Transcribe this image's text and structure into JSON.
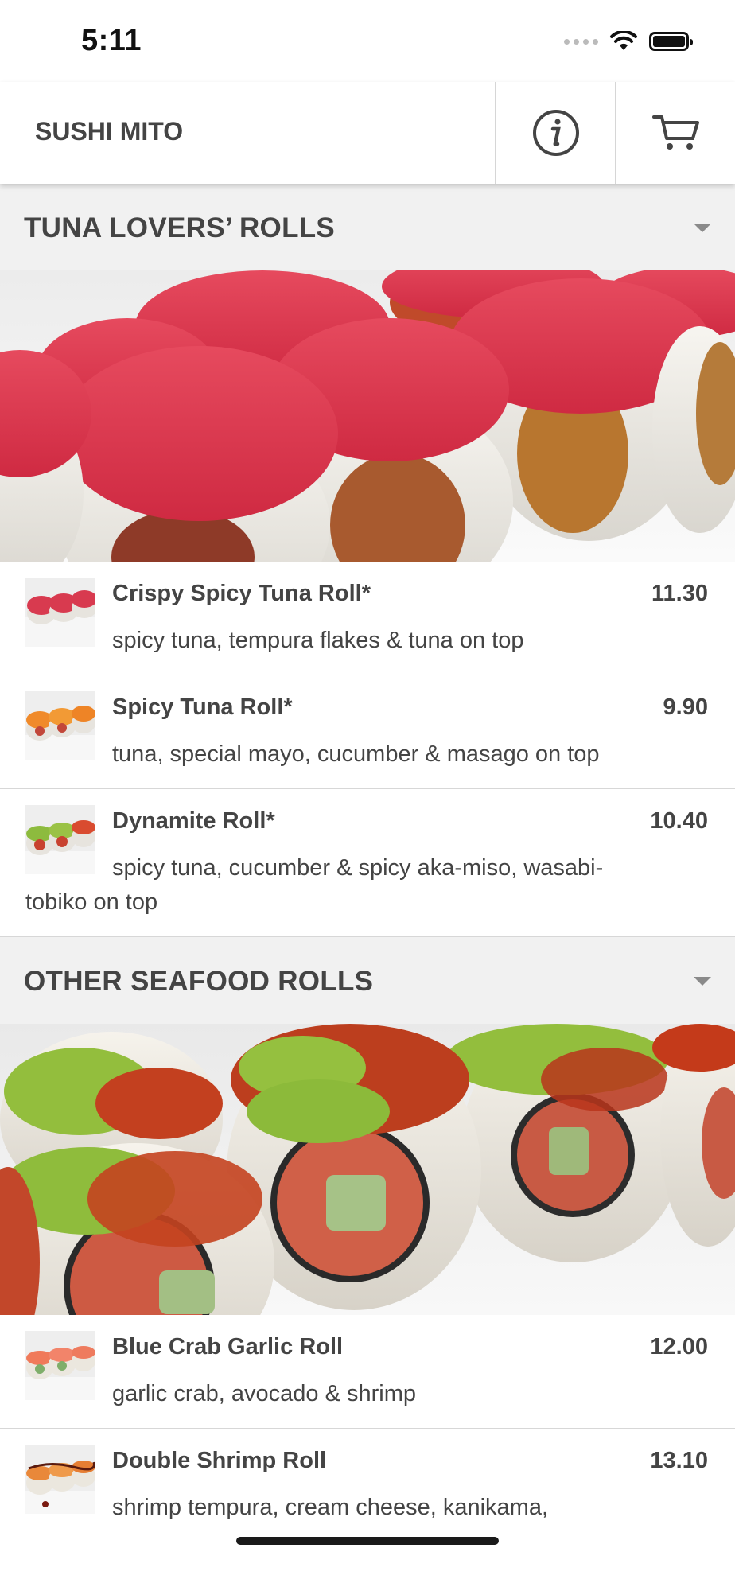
{
  "status": {
    "time": "5:11"
  },
  "navbar": {
    "title": "SUSHI MITO"
  },
  "sections": [
    {
      "title": "TUNA LOVERS’ ROLLS",
      "items": [
        {
          "name": "Crispy Spicy Tuna Roll*",
          "price": "11.30",
          "desc": "spicy tuna, tempura flakes & tuna on top"
        },
        {
          "name": "Spicy Tuna Roll*",
          "price": "9.90",
          "desc": "tuna, special mayo, cucumber & masago on top"
        },
        {
          "name": "Dynamite Roll*",
          "price": "10.40",
          "desc": "spicy tuna, cucumber & spicy aka-miso, wasabi-tobiko on top"
        }
      ]
    },
    {
      "title": "OTHER SEAFOOD ROLLS",
      "items": [
        {
          "name": "Blue Crab Garlic Roll",
          "price": "12.00",
          "desc": "garlic crab, avocado & shrimp"
        },
        {
          "name": "Double Shrimp Roll",
          "price": "13.10",
          "desc": "shrimp tempura, cream cheese, kanikama,"
        }
      ]
    }
  ],
  "colors": {
    "tuna": "#e0384f",
    "rice": "#f3f1ec",
    "tobiko_green": "#8fbb3c",
    "sauce": "#c8421f"
  },
  "icons": [
    "wifi-icon",
    "battery-icon",
    "info-icon",
    "cart-icon",
    "chevron-down-icon"
  ]
}
